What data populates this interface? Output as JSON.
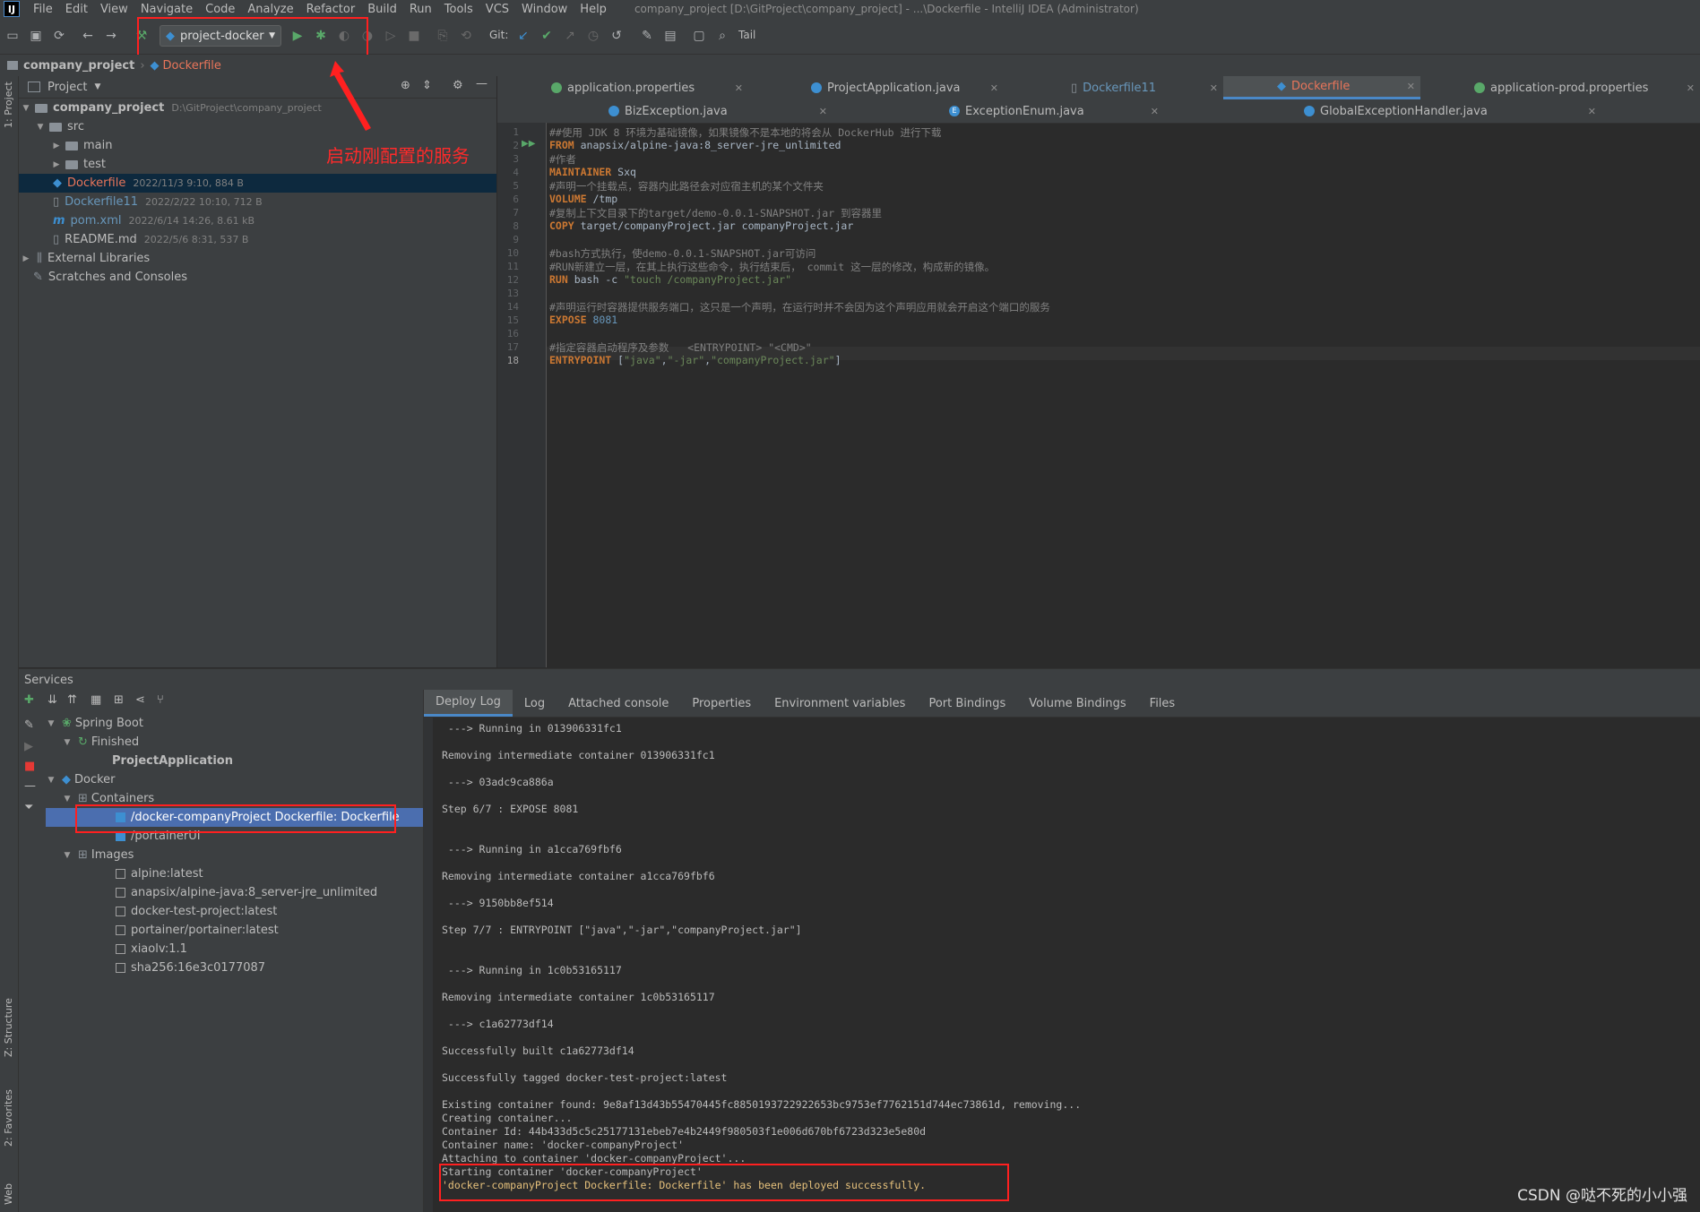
{
  "menu": {
    "logo": "IJ",
    "items": [
      "File",
      "Edit",
      "View",
      "Navigate",
      "Code",
      "Analyze",
      "Refactor",
      "Build",
      "Run",
      "Tools",
      "VCS",
      "Window",
      "Help"
    ],
    "window_title": "company_project [D:\\GitProject\\company_project] - ...\\Dockerfile - IntelliJ IDEA (Administrator)"
  },
  "toolbar": {
    "run_config": "project-docker",
    "git_label": "Git:",
    "tail_label": "Tail"
  },
  "navbar": {
    "project": "company_project",
    "file": "Dockerfile"
  },
  "annotation": "启动刚配置的服务",
  "project_panel": {
    "header": "Project",
    "left_stripe_label": "1: Project",
    "root_name": "company_project",
    "root_path": "D:\\GitProject\\company_project",
    "items": [
      {
        "name": "src"
      },
      {
        "name": "main"
      },
      {
        "name": "test"
      },
      {
        "name": "Dockerfile",
        "meta": "2022/11/3 9:10, 884 B"
      },
      {
        "name": "Dockerfile11",
        "meta": "2022/2/22 10:10, 712 B"
      },
      {
        "name": "pom.xml",
        "meta": "2022/6/14 14:26, 8.61 kB"
      },
      {
        "name": "README.md",
        "meta": "2022/5/6 8:31, 537 B"
      },
      {
        "name": "External Libraries"
      },
      {
        "name": "Scratches and Consoles"
      }
    ]
  },
  "editor": {
    "tabs_row1": [
      "application.properties",
      "ProjectApplication.java",
      "Dockerfile11",
      "Dockerfile",
      "application-prod.properties"
    ],
    "tabs_row2": [
      "BizException.java",
      "ExceptionEnum.java",
      "GlobalExceptionHandler.java"
    ],
    "lines": {
      "l1": "##使用 JDK 8 环境为基础镜像，如果镜像不是本地的将会从 DockerHub 进行下载",
      "l2_kw": "FROM",
      "l2": " anapsix/alpine-java:8_server-jre_unlimited",
      "l3": "#作者",
      "l4_kw": "MAINTAINER",
      "l4": " Sxq",
      "l5": "#声明一个挂载点，容器内此路径会对应宿主机的某个文件夹",
      "l6_kw": "VOLUME",
      "l6": " /tmp",
      "l7": "#复制上下文目录下的target/demo-0.0.1-SNAPSHOT.jar 到容器里",
      "l8_kw": "COPY",
      "l8": " target/companyProject.jar companyProject.jar",
      "l10": "#bash方式执行，使demo-0.0.1-SNAPSHOT.jar可访问",
      "l11": "#RUN新建立一层，在其上执行这些命令，执行结束后， commit 这一层的修改，构成新的镜像。",
      "l12_kw": "RUN",
      "l12": " bash -c ",
      "l12_str": "\"touch /companyProject.jar\"",
      "l14": "#声明运行时容器提供服务端口，这只是一个声明，在运行时并不会因为这个声明应用就会开启这个端口的服务",
      "l15_kw": "EXPOSE",
      "l15_num": " 8081",
      "l17": "#指定容器启动程序及参数   <ENTRYPOINT> \"<CMD>\"",
      "l18_kw": "ENTRYPOINT",
      "l18_a": " [",
      "l18_s1": "\"java\"",
      "l18_c1": ",",
      "l18_s2": "\"-jar\"",
      "l18_c2": ",",
      "l18_s3": "\"companyProject.jar\"",
      "l18_b": "]"
    }
  },
  "services": {
    "header": "Services",
    "tree": {
      "spring_boot": "Spring Boot",
      "finished": "Finished",
      "app": "ProjectApplication",
      "docker": "Docker",
      "containers": "Containers",
      "container1": "/docker-companyProject Dockerfile: Dockerfile",
      "container2": "/portainerUI",
      "images": "Images",
      "image_list": [
        "alpine:latest",
        "anapsix/alpine-java:8_server-jre_unlimited",
        "docker-test-project:latest",
        "portainer/portainer:latest",
        "xiaolv:1.1",
        "sha256:16e3c0177087"
      ]
    },
    "log_tabs": [
      "Deploy Log",
      "Log",
      "Attached console",
      "Properties",
      "Environment variables",
      "Port Bindings",
      "Volume Bindings",
      "Files"
    ],
    "log": {
      "r1": " ---> Running in 013906331fc1",
      "r2": "Removing intermediate container 013906331fc1",
      "r3": " ---> 03adc9ca886a",
      "r4": "Step 6/7 : EXPOSE 8081",
      "r5": " ---> Running in a1cca769fbf6",
      "r6": "Removing intermediate container a1cca769fbf6",
      "r7": " ---> 9150bb8ef514",
      "r8": "Step 7/7 : ENTRYPOINT [\"java\",\"-jar\",\"companyProject.jar\"]",
      "r9": " ---> Running in 1c0b53165117",
      "r10": "Removing intermediate container 1c0b53165117",
      "r11": " ---> c1a62773df14",
      "r12": "Successfully built c1a62773df14",
      "r13": "Successfully tagged docker-test-project:latest",
      "r14": "Existing container found: 9e8af13d43b55470445fc8850193722922653bc9753ef7762151d744ec73861d, removing...",
      "r15": "Creating container...",
      "r16": "Container Id: 44b433d5c5c25177131ebeb7e4b2449f980503f1e006d670bf6723d323e5e80d",
      "r17": "Container name: 'docker-companyProject'",
      "r18": "Attaching to container 'docker-companyProject'...",
      "r19": "Starting container 'docker-companyProject'",
      "r20": "'docker-companyProject Dockerfile: Dockerfile' has been deployed successfully."
    },
    "left_stripe": {
      "structure": "Z: Structure",
      "favorites": "2: Favorites",
      "web": "Web"
    }
  },
  "watermark": "CSDN @哒不死的小小强",
  "colors": {
    "accent": "#4a88c7",
    "highlight_red": "#ff2020",
    "success_yellow": "#e5c07b"
  }
}
